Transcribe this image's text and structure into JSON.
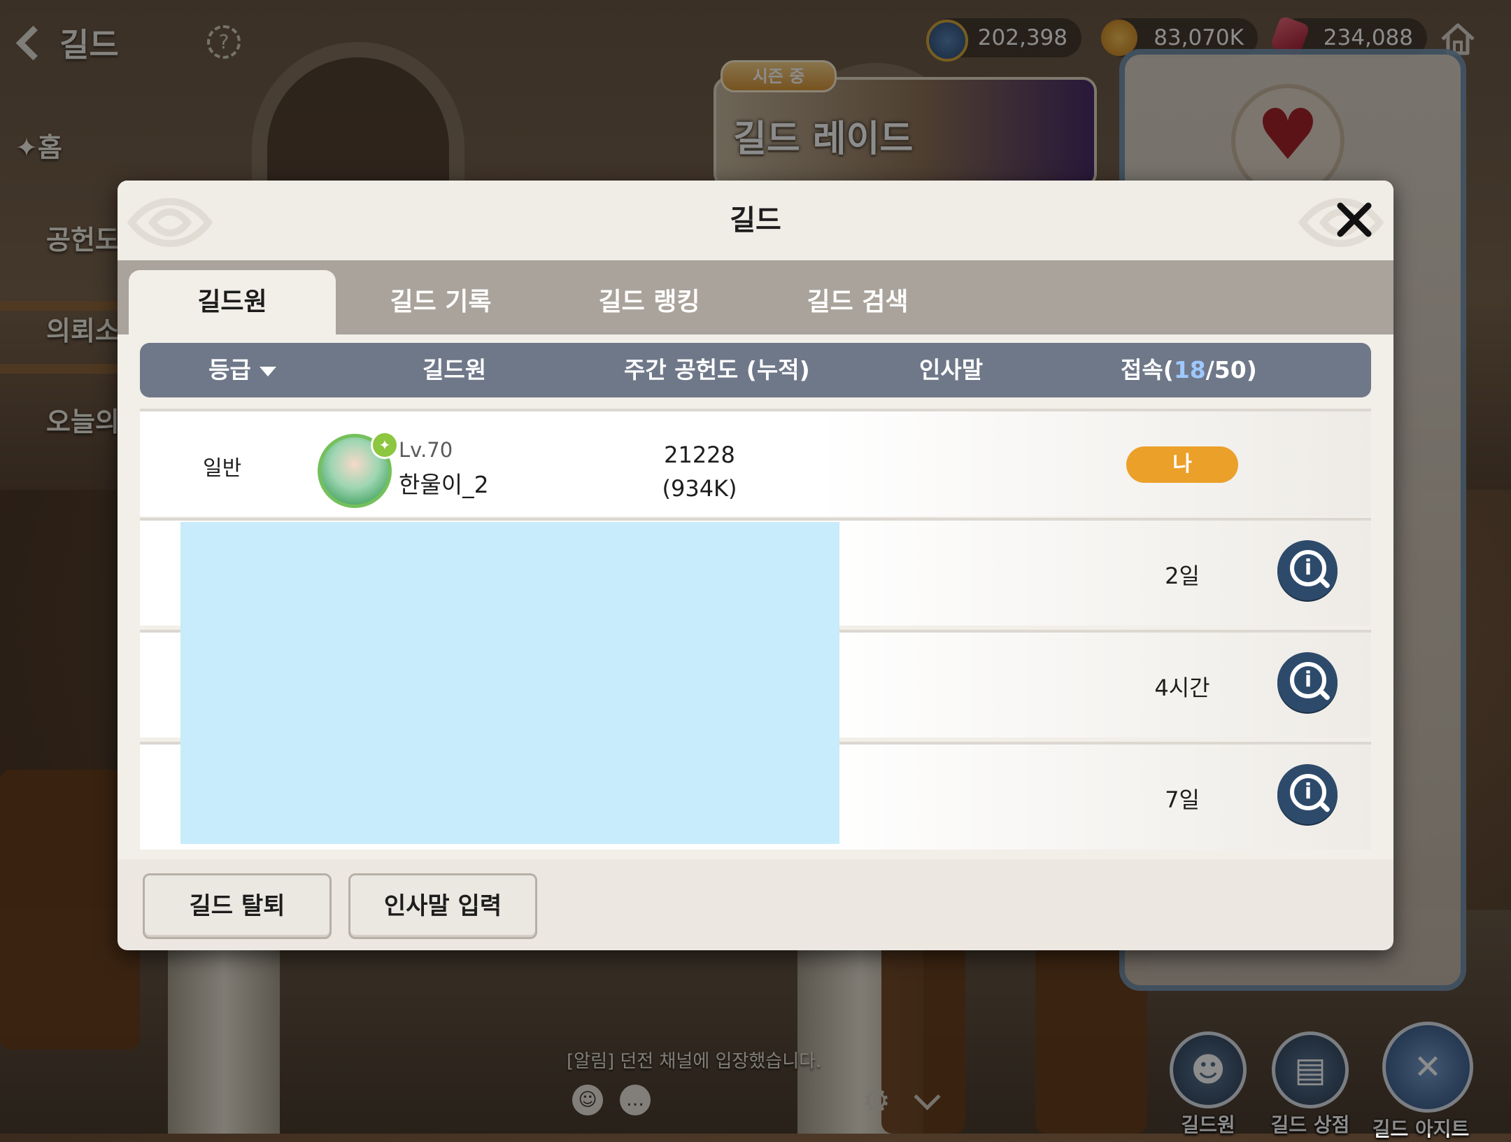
{
  "header": {
    "title": "길드",
    "back_icon": "chevron-left-icon",
    "help_icon": "help-icon"
  },
  "currency": [
    {
      "icon": "guild-coin-icon",
      "value": "202,398",
      "color": "#d9a93b"
    },
    {
      "icon": "gold-coin-icon",
      "value": "83,070K",
      "color": "#e0a12e"
    },
    {
      "icon": "red-gem-icon",
      "value": "234,088",
      "color": "#c43a4c"
    }
  ],
  "side_menu": {
    "home": "✦홈",
    "contribution": "공헌도",
    "request": "의뢰소",
    "today": "오늘의"
  },
  "raid": {
    "season": "시즌 중",
    "title": "길드 레이드"
  },
  "modal": {
    "title": "길드",
    "tabs": [
      "길드원",
      "길드 기록",
      "길드 랭킹",
      "길드 검색"
    ],
    "active_tab": "길드원",
    "columns": {
      "rank": "등급",
      "member": "길드원",
      "weekly_contribution": "주간 공헌도 (누적)",
      "greeting": "인사말",
      "online_label": "접속(",
      "online_now": "18",
      "online_total": "/50)"
    },
    "self_row": {
      "rank": "일반",
      "level": "Lv.70",
      "name": "한울이_2",
      "weekly": "21228",
      "cumulative": "(934K)",
      "badge": "나"
    },
    "member_rows": [
      {
        "last_login": "2일"
      },
      {
        "last_login": "4시간"
      },
      {
        "last_login": "7일"
      }
    ],
    "buttons": {
      "leave": "길드 탈퇴",
      "greeting": "인사말 입력"
    }
  },
  "bottom": {
    "notice": "[알림] 던전 채널에 입장했습니다.",
    "buttons": [
      "길드원",
      "길드 상점",
      "길드 아지트"
    ]
  },
  "colors": {
    "accent_orange": "#eba02a",
    "header_slate": "#6f7889",
    "info_navy": "#2e4a6b",
    "online_blue": "#9ec8ff"
  }
}
